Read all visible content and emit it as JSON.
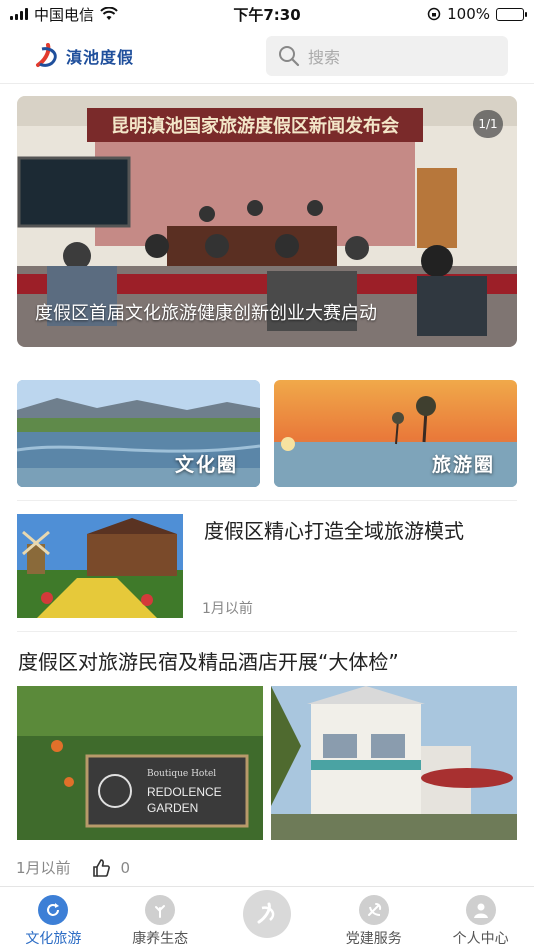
{
  "status_bar": {
    "carrier": "中国电信",
    "time": "下午7:30",
    "battery_percent": "100%",
    "battery_level": 1.0
  },
  "header": {
    "logo_text": "滇池度假",
    "search_placeholder": "搜索"
  },
  "banner": {
    "counter": "1/1",
    "sign_text": "昆明滇池国家旅游度假区新闻发布会",
    "caption": "度假区首届文化旅游健康创新创业大赛启动"
  },
  "categories": [
    {
      "label": "文化圈"
    },
    {
      "label": "旅游圈"
    }
  ],
  "articles": [
    {
      "title": "度假区精心打造全域旅游模式",
      "time": "1月以前"
    },
    {
      "title": "度假区对旅游民宿及精品酒店开展“大体检”",
      "time": "1月以前",
      "likes": "0",
      "sign_text_1": "Boutique Hotel",
      "sign_text_2": "REDOLENCE",
      "sign_text_3": "GARDEN"
    }
  ],
  "tab_bar": [
    {
      "label": "文化旅游",
      "icon": "refresh-icon",
      "active": true
    },
    {
      "label": "康养生态",
      "icon": "leaf-icon"
    },
    {
      "label": "",
      "icon": "home-logo-icon"
    },
    {
      "label": "党建服务",
      "icon": "party-emblem-icon"
    },
    {
      "label": "个人中心",
      "icon": "user-icon"
    }
  ],
  "colors": {
    "accent": "#3d7fd6",
    "logo": "#1f4f9c",
    "muted": "#888888"
  }
}
